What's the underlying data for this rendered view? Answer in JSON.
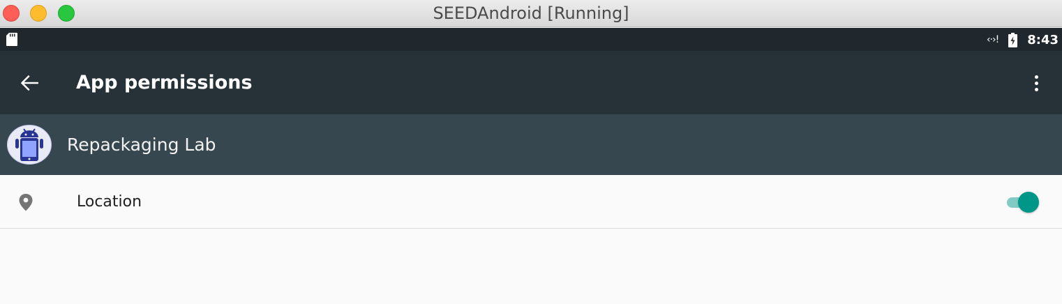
{
  "window": {
    "title": "SEEDAndroid [Running]"
  },
  "status_bar": {
    "left_icon": "sd-card-icon",
    "network_icon": "network-transfer-icon",
    "battery_icon": "battery-charging-icon",
    "time": "8:43"
  },
  "app_bar": {
    "title": "App permissions",
    "back_icon": "arrow-back-icon",
    "menu_icon": "more-vert-icon"
  },
  "app_header": {
    "name": "Repackaging Lab",
    "icon": "android-app-icon"
  },
  "permissions": [
    {
      "icon": "location-pin-icon",
      "label": "Location",
      "enabled": true
    }
  ],
  "colors": {
    "status_bar": "#20282d",
    "app_bar": "#263238",
    "app_header": "#37474f",
    "accent": "#009688",
    "accent_light": "#80cbc4"
  }
}
